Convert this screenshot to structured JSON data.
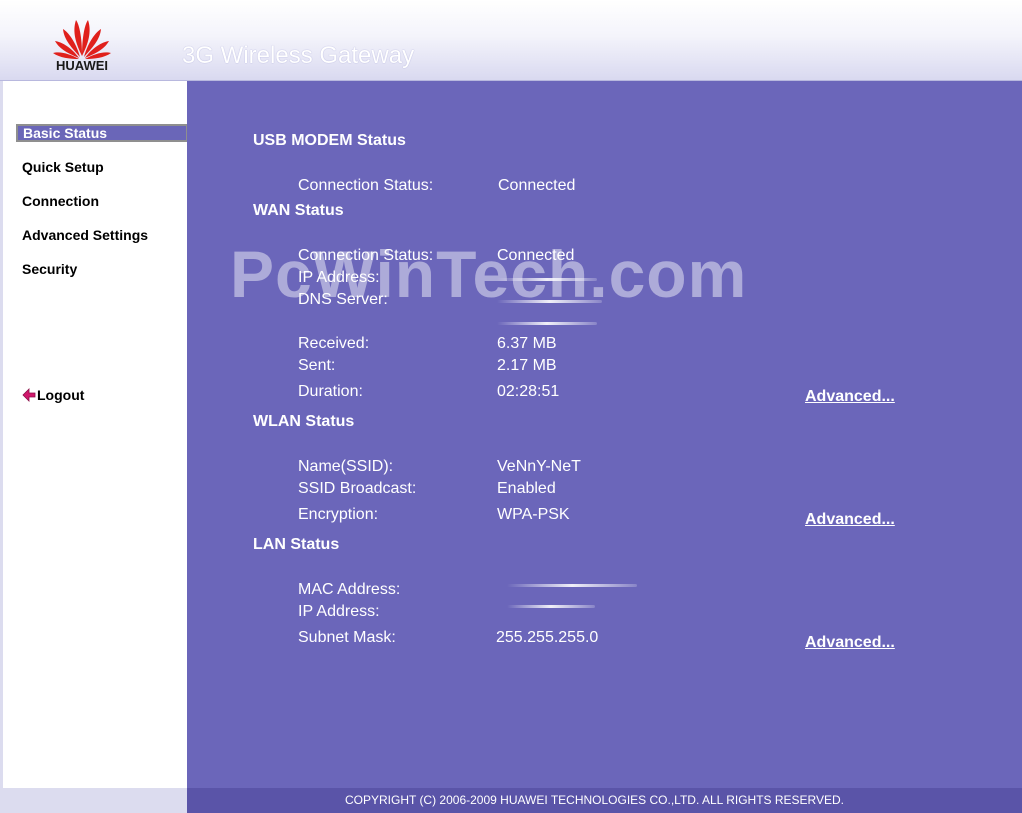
{
  "header": {
    "brand": "HUAWEI",
    "title": "3G Wireless Gateway"
  },
  "sidebar": {
    "items": [
      {
        "label": "Basic Status",
        "active": true
      },
      {
        "label": "Quick Setup"
      },
      {
        "label": "Connection"
      },
      {
        "label": "Advanced Settings"
      },
      {
        "label": "Security"
      }
    ],
    "logout": "Logout"
  },
  "usb": {
    "title": "USB MODEM Status",
    "connection_status_label": "Connection Status:",
    "connection_status": "Connected"
  },
  "wan": {
    "title": "WAN Status",
    "connection_status_label": "Connection Status:",
    "connection_status": "Connected",
    "ip_label": "IP Address:",
    "dns_label": "DNS Server:",
    "received_label": "Received:",
    "received": "6.37 MB",
    "sent_label": "Sent:",
    "sent": "2.17 MB",
    "duration_label": "Duration:",
    "duration": "02:28:51",
    "advanced": "Advanced..."
  },
  "wlan": {
    "title": "WLAN Status",
    "ssid_label": "Name(SSID):",
    "ssid": "VeNnY-NeT",
    "broadcast_label": "SSID Broadcast:",
    "broadcast": "Enabled",
    "encryption_label": "Encryption:",
    "encryption": "WPA-PSK",
    "advanced": "Advanced..."
  },
  "lan": {
    "title": "LAN Status",
    "mac_label": "MAC Address:",
    "ip_label": "IP Address:",
    "subnet_label": "Subnet Mask:",
    "subnet": "255.255.255.0",
    "advanced": "Advanced..."
  },
  "watermark": "PcWinTech.com",
  "footer": "COPYRIGHT (C) 2006-2009 HUAWEI TECHNOLOGIES CO.,LTD. ALL RIGHTS RESERVED.",
  "colors": {
    "main_bg": "#6b66ba",
    "footer_bg": "#5a54a8",
    "brand_red": "#e0201c"
  }
}
